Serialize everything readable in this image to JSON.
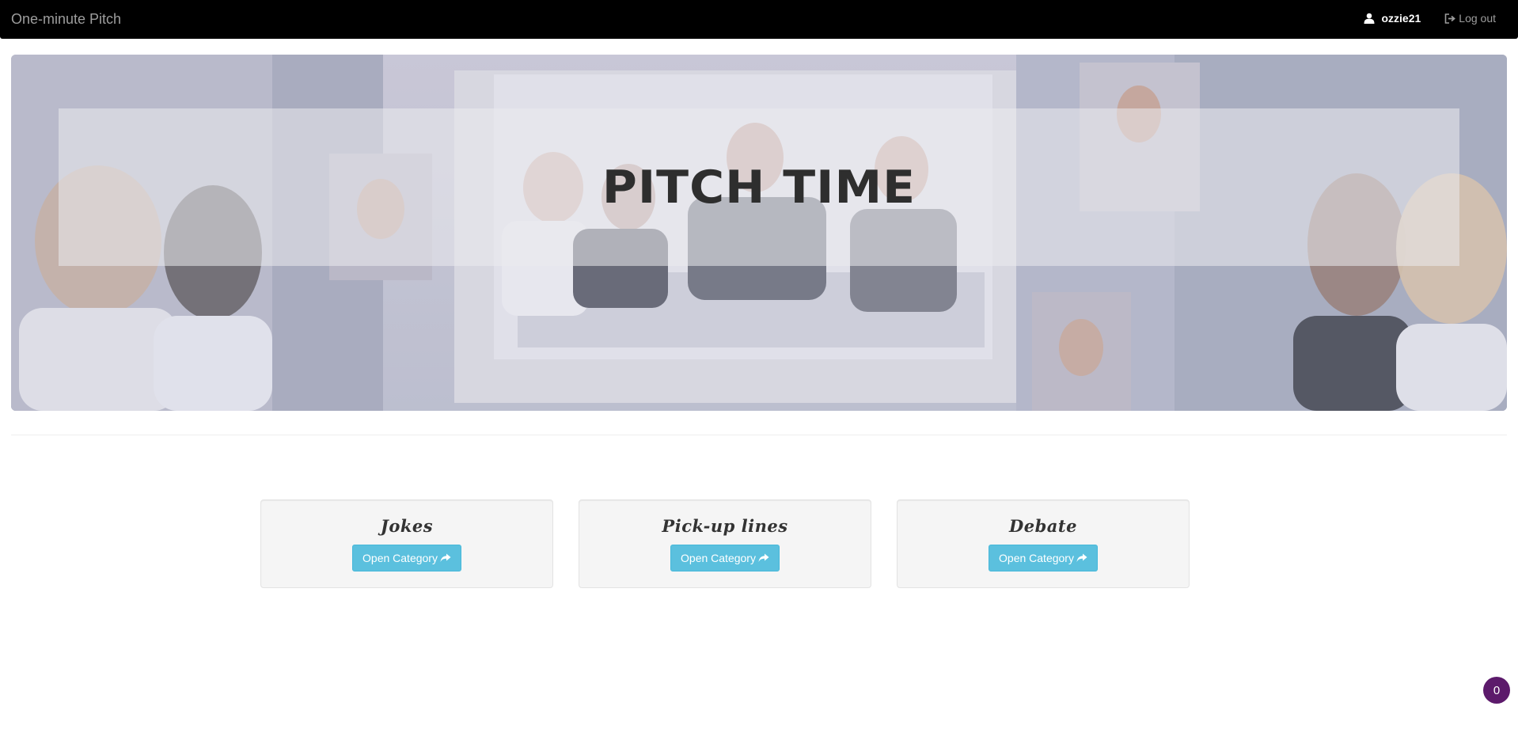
{
  "navbar": {
    "brand": "One-minute Pitch",
    "user": {
      "username": "ozzie21",
      "icon": "user-icon"
    },
    "logout": {
      "label": "Log out",
      "icon": "logout-icon"
    }
  },
  "hero": {
    "title": "PITCH TIME",
    "background": "business-team-meeting-photo"
  },
  "categories": [
    {
      "title": "Jokes",
      "button_label": "Open Category",
      "icon": "share-arrow-icon"
    },
    {
      "title": "Pick-up lines",
      "button_label": "Open Category ",
      "icon": "share-arrow-icon"
    },
    {
      "title": "Debate",
      "button_label": "Open Category ",
      "icon": "share-arrow-icon"
    }
  ],
  "badge": {
    "count": "0"
  },
  "colors": {
    "navbar_bg": "#000000",
    "button_info": "#5bc0de",
    "badge_bg": "#5c1a6b",
    "card_bg": "#f5f5f5"
  }
}
